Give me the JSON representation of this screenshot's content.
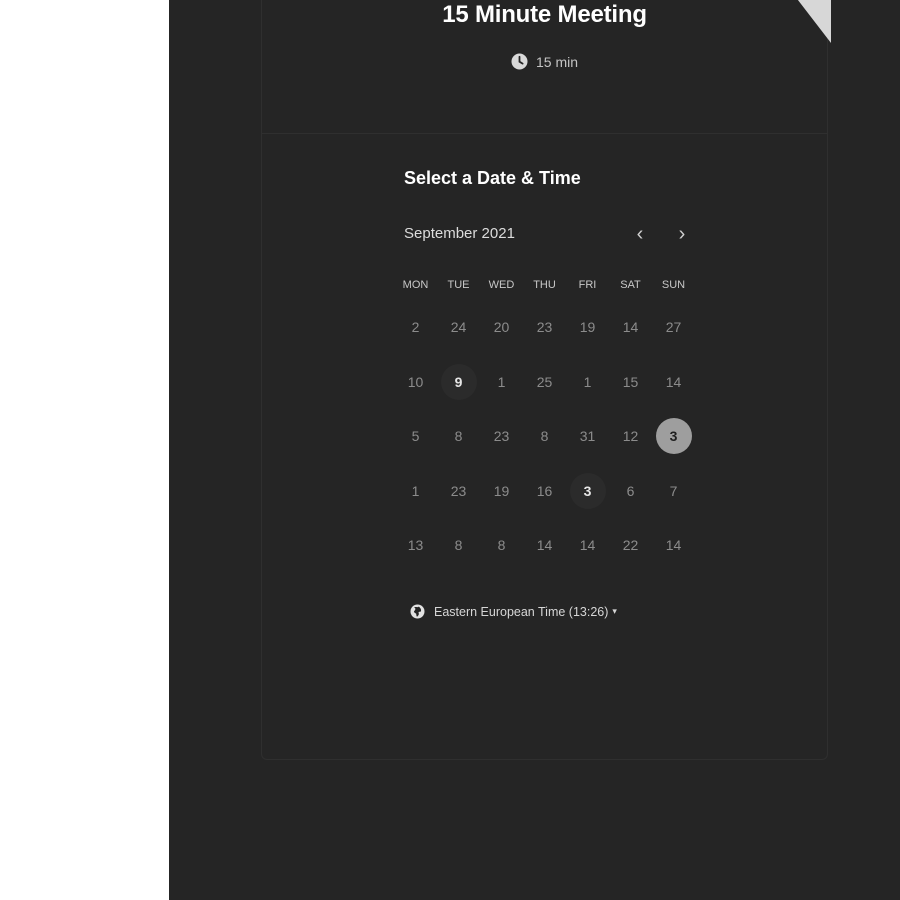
{
  "event": {
    "title": "15 Minute Meeting",
    "duration": "15 min",
    "duration_icon": "clock-icon"
  },
  "scheduler": {
    "section_title": "Select a Date & Time",
    "month": "September 2021",
    "prev_icon": "chevron-left-icon",
    "next_icon": "chevron-right-icon",
    "prev_glyph": "‹",
    "next_glyph": "›",
    "weekdays": [
      "MON",
      "TUE",
      "WED",
      "THU",
      "FRI",
      "SAT",
      "SUN"
    ],
    "weeks": [
      [
        {
          "d": "2"
        },
        {
          "d": "24"
        },
        {
          "d": "20"
        },
        {
          "d": "23"
        },
        {
          "d": "19"
        },
        {
          "d": "14"
        },
        {
          "d": "27"
        }
      ],
      [
        {
          "d": "10"
        },
        {
          "d": "9",
          "state": "available"
        },
        {
          "d": "1"
        },
        {
          "d": "25"
        },
        {
          "d": "1"
        },
        {
          "d": "15"
        },
        {
          "d": "14"
        }
      ],
      [
        {
          "d": "5"
        },
        {
          "d": "8"
        },
        {
          "d": "23"
        },
        {
          "d": "8"
        },
        {
          "d": "31"
        },
        {
          "d": "12"
        },
        {
          "d": "3",
          "state": "selected"
        }
      ],
      [
        {
          "d": "1"
        },
        {
          "d": "23"
        },
        {
          "d": "19"
        },
        {
          "d": "16"
        },
        {
          "d": "3",
          "state": "available"
        },
        {
          "d": "6"
        },
        {
          "d": "7"
        }
      ],
      [
        {
          "d": "13"
        },
        {
          "d": "8"
        },
        {
          "d": "8"
        },
        {
          "d": "14"
        },
        {
          "d": "14"
        },
        {
          "d": "22"
        },
        {
          "d": "14"
        }
      ]
    ]
  },
  "timezone": {
    "label": "Eastern European Time (13:26)",
    "icon": "globe-icon",
    "caret": "▾"
  },
  "colors": {
    "background": "#252525",
    "selected_day": "#9e9e9e",
    "text_primary": "#ffffff",
    "text_muted": "#8c8c8c"
  }
}
